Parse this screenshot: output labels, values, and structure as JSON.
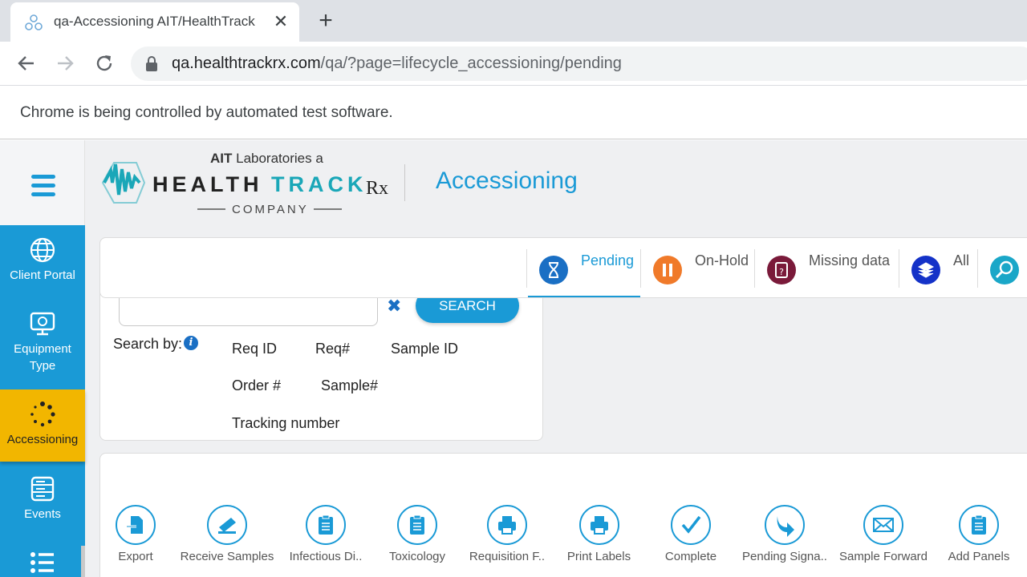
{
  "browser": {
    "tab_title": "qa-Accessioning AIT/HealthTrack",
    "url_host": "qa.healthtrackrx.com",
    "url_path": "/qa/?page=lifecycle_accessioning/pending",
    "infobar_text": "Chrome is being controlled by automated test software."
  },
  "header": {
    "logo_top": "AIT Laboratories a",
    "logo_brand": "HEALTHTRACK",
    "logo_rx": "Rx",
    "logo_company": "COMPANY",
    "page_title": "Accessioning"
  },
  "sidebar": {
    "items": [
      {
        "label": "Client Portal",
        "icon": "globe-icon"
      },
      {
        "label": "Equipment Type",
        "icon": "monitor-icon"
      },
      {
        "label": "Accessioning",
        "icon": "spinner-icon",
        "active": true
      },
      {
        "label": "Events",
        "icon": "server-list-icon"
      },
      {
        "label": "",
        "icon": "list-icon"
      }
    ]
  },
  "status_tabs": [
    {
      "label": "Pending",
      "active": true,
      "color": "#1a6fc4"
    },
    {
      "label": "On-Hold",
      "color": "#f07a2a"
    },
    {
      "label": "Missing data",
      "color": "#7a1a3a"
    },
    {
      "label": "All",
      "color": "#1432c8"
    }
  ],
  "search": {
    "button_label": "SEARCH",
    "search_by_label": "Search by:",
    "options": [
      "Req ID",
      "Req#",
      "Sample ID",
      "Order #",
      "Sample#",
      "Tracking number"
    ]
  },
  "actions": [
    {
      "label": "Export"
    },
    {
      "label": "Receive Samples"
    },
    {
      "label": "Infectious Di.."
    },
    {
      "label": "Toxicology"
    },
    {
      "label": "Requisition F.."
    },
    {
      "label": "Print Labels"
    },
    {
      "label": "Complete"
    },
    {
      "label": "Pending Signa.."
    },
    {
      "label": "Sample Forward"
    },
    {
      "label": "Add Panels"
    }
  ],
  "colors": {
    "primary": "#1a9ad6",
    "active_nav": "#f2b600"
  }
}
